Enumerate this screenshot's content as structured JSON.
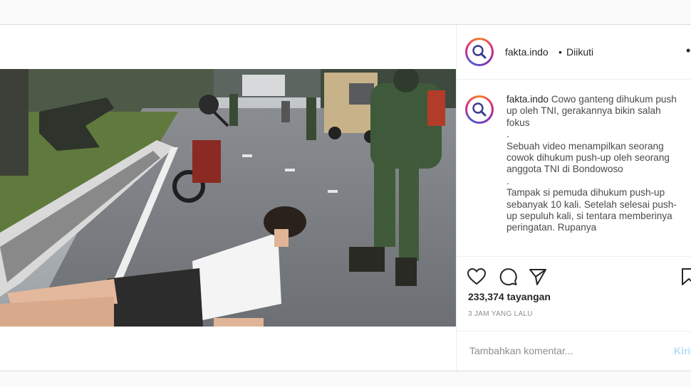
{
  "account": {
    "username": "fakta.indo",
    "separator": "•",
    "follow_status": "Diikuti",
    "more_icon": "ellipsis-icon"
  },
  "caption": {
    "username": "fakta.indo",
    "text": " Cowo ganteng dihukum push up oleh TNI, gerakannya bikin salah fokus\n.\nSebuah video menampilkan seorang cowok dihukum push-up oleh seorang anggota TNI di Bondowoso\n.\nTampak si pemuda dihukum push-up sebanyak 10 kali. Setelah selesai push-up sepuluh kali, si tentara memberinya peringatan. Rupanya"
  },
  "actions": {
    "icons": [
      "heart-icon",
      "comment-icon",
      "share-icon",
      "bookmark-icon"
    ]
  },
  "stats": {
    "views": "233,374 tayangan",
    "timestamp": "3 JAM YANG LALU"
  },
  "comment_box": {
    "placeholder": "Tambahkan komentar...",
    "post_label": "Kirim"
  },
  "colors": {
    "link_disabled": "#b2dffc",
    "border": "#dbdbdb",
    "muted_text": "#8e8e8e"
  }
}
